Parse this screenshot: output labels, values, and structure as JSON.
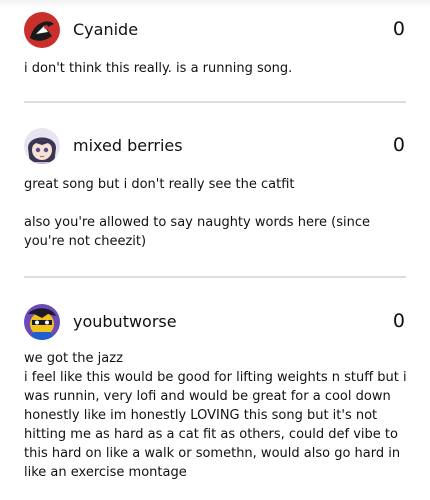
{
  "comments": [
    {
      "user": "Cyanide",
      "avatar_icon": "cyanide-avatar-icon",
      "score": "0",
      "paragraphs": [
        "i don't think this really. is a running song."
      ]
    },
    {
      "user": "mixed berries",
      "avatar_icon": "anime-girl-avatar-icon",
      "score": "0",
      "paragraphs": [
        "great song but i don't really see the catfit",
        "also you're allowed to say naughty words here (since you're not cheezit)"
      ]
    },
    {
      "user": "youbutworse",
      "avatar_icon": "yellow-character-avatar-icon",
      "score": "0",
      "paragraphs": [
        "we got the jazz\ni feel like this would be good for lifting weights n stuff but i was runnin, very lofi and would be great for a cool down honestly like im honestly LOVING this song but it's not hitting me as hard as a cat fit as others, could def vibe to this hard on like a walk or somethn, would also go hard in like an exercise montage"
      ]
    }
  ],
  "colors": {
    "divider": "#dedede",
    "text": "#111111",
    "avatar_red": "#c9302c"
  }
}
